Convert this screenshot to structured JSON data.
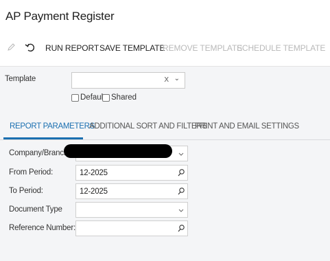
{
  "page": {
    "title": "AP Payment Register"
  },
  "toolbar": {
    "edit_icon": "pencil-icon",
    "undo_icon": "undo-icon",
    "run_report": "RUN REPORT",
    "save_template": "SAVE TEMPLATE",
    "remove_template": "REMOVE TEMPLATE",
    "schedule_template": "SCHEDULE TEMPLATE"
  },
  "template_section": {
    "label": "Template",
    "value": "",
    "clear_glyph": "X",
    "dropdown_glyph": "⌄",
    "default_label": "Default",
    "shared_label": "Shared",
    "default_checked": false,
    "shared_checked": false
  },
  "tabs": [
    {
      "label": "REPORT PARAMETERS",
      "active": true
    },
    {
      "label": "ADDITIONAL SORT AND FILTERS",
      "active": false
    },
    {
      "label": "PRINT AND EMAIL SETTINGS",
      "active": false
    }
  ],
  "parameters": {
    "company_branch": {
      "label": "Company/Branch:",
      "value": ""
    },
    "from_period": {
      "label": "From Period:",
      "value": "12-2025"
    },
    "to_period": {
      "label": "To Period:",
      "value": "12-2025"
    },
    "document_type": {
      "label": "Document Type",
      "value": ""
    },
    "reference_number": {
      "label": "Reference Number:",
      "value": ""
    }
  },
  "colors": {
    "accent": "#1a6fb0",
    "panel_bg": "#f4f5f7",
    "disabled_text": "#b9b9b9"
  }
}
